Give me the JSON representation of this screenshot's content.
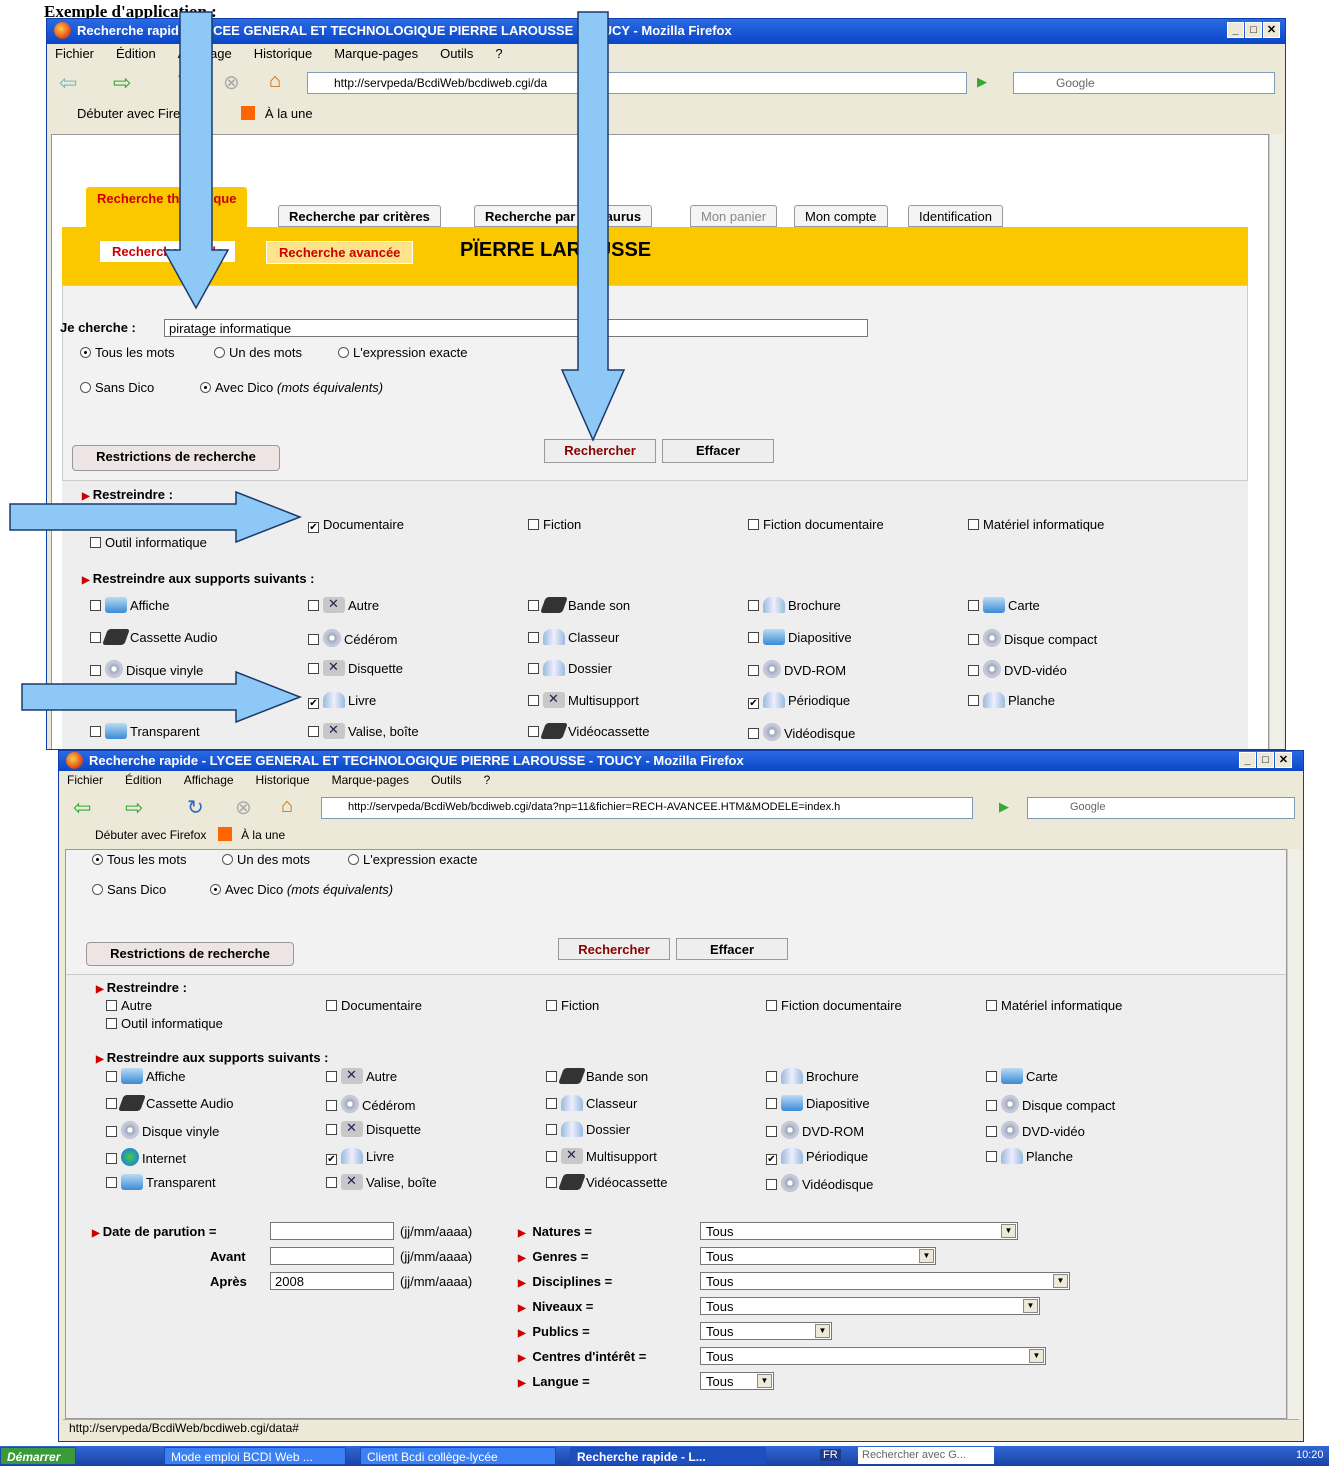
{
  "doc_heading": "Exemple d'application :",
  "browser": {
    "title": "Recherche rapide - LYCEE GENERAL ET TECHNOLOGIQUE PIERRE LAROUSSE - TOUCY - Mozilla Firefox",
    "menu": [
      "Fichier",
      "Édition",
      "Affichage",
      "Historique",
      "Marque-pages",
      "Outils",
      "?"
    ],
    "url1": "http://servpeda/BcdiWeb/bcdiweb.cgi/da",
    "url2": "http://servpeda/BcdiWeb/bcdiweb.cgi/data?np=11&fichier=RECH-AVANCEE.HTM&MODELE=index.h",
    "search_placeholder": "Google",
    "bookmarks": [
      "Débuter avec Firefox",
      "À la une"
    ],
    "status": "http://servpeda/BcdiWeb/bcdiweb.cgi/data#"
  },
  "tabs": [
    "Recherche thématique",
    "Recherche par critères",
    "Recherche par thésaurus",
    "Mon panier",
    "Mon compte",
    "Identification"
  ],
  "subtabs": [
    "Recherche simple",
    "Recherche avancée"
  ],
  "school": "PÏERRE LAROUSSE",
  "search": {
    "label": "Je cherche :",
    "value": "piratage informatique",
    "modes": [
      "Tous les mots",
      "Un des mots",
      "L'expression exacte"
    ],
    "dico": [
      "Sans Dico",
      "Avec Dico",
      "(mots équivalents)"
    ]
  },
  "buttons": {
    "restrictions": "Restrictions de recherche",
    "search": "Rechercher",
    "clear": "Effacer"
  },
  "restrict": {
    "title": "Restreindre :",
    "items": [
      "Autre",
      "Documentaire",
      "Fiction",
      "Fiction documentaire",
      "Matériel informatique",
      "Outil informatique"
    ],
    "checked_win1": [
      "Documentaire"
    ]
  },
  "supports": {
    "title": "Restreindre aux supports suivants :",
    "items_win1": [
      "Affiche",
      "Autre",
      "Bande son",
      "Brochure",
      "Carte",
      "Cassette Audio",
      "Cédérom",
      "Classeur",
      "Diapositive",
      "Disque compact",
      "Disque vinyle",
      "Disquette",
      "Dossier",
      "DVD-ROM",
      "DVD-vidéo",
      "",
      "Livre",
      "Multisupport",
      "Périodique",
      "Planche",
      "Transparent",
      "Valise, boîte",
      "Vidéocassette",
      "Vidéodisque"
    ],
    "items_win2": [
      "Affiche",
      "Autre",
      "Bande son",
      "Brochure",
      "Carte",
      "Cassette Audio",
      "Cédérom",
      "Classeur",
      "Diapositive",
      "Disque compact",
      "Disque vinyle",
      "Disquette",
      "Dossier",
      "DVD-ROM",
      "DVD-vidéo",
      "Internet",
      "Livre",
      "Multisupport",
      "Périodique",
      "Planche",
      "Transparent",
      "Valise, boîte",
      "Vidéocassette",
      "Vidéodisque"
    ],
    "checked": [
      "Livre",
      "Périodique"
    ],
    "icons": [
      "image-icon",
      "tools-icon",
      "tape-icon",
      "book-icon",
      "image-icon",
      "tape-icon",
      "cd-icon",
      "book-icon",
      "image-icon",
      "cd-icon",
      "vinyl-icon",
      "tools-icon",
      "book-icon",
      "cd-icon",
      "cd-icon",
      "globe-icon",
      "book-icon",
      "tools-icon",
      "book-icon",
      "book-icon",
      "image-icon",
      "tools-icon",
      "tape-icon",
      "cd-icon"
    ]
  },
  "dates": {
    "parution": "Date de parution =",
    "avant": "Avant",
    "apres": "Après",
    "format": "(jj/mm/aaaa)",
    "apres_value": "2008"
  },
  "filters": [
    {
      "label": "Natures =",
      "value": "Tous"
    },
    {
      "label": "Genres =",
      "value": "Tous"
    },
    {
      "label": "Disciplines =",
      "value": "Tous"
    },
    {
      "label": "Niveaux =",
      "value": "Tous"
    },
    {
      "label": "Publics =",
      "value": "Tous"
    },
    {
      "label": "Centres d'intérêt =",
      "value": "Tous"
    },
    {
      "label": "Langue =",
      "value": "Tous"
    }
  ],
  "taskbar": {
    "start": "Démarrer",
    "items": [
      "Mode emploi BCDI Web ...",
      "Client Bcdi collège-lycée",
      "Recherche rapide - L..."
    ],
    "lang": "FR",
    "search": "Rechercher avec G...",
    "time": "10:20"
  },
  "colors": {
    "tab_yellow": "#fbc800",
    "accent_red": "#c00000",
    "arrow": "#8ec8f6"
  }
}
